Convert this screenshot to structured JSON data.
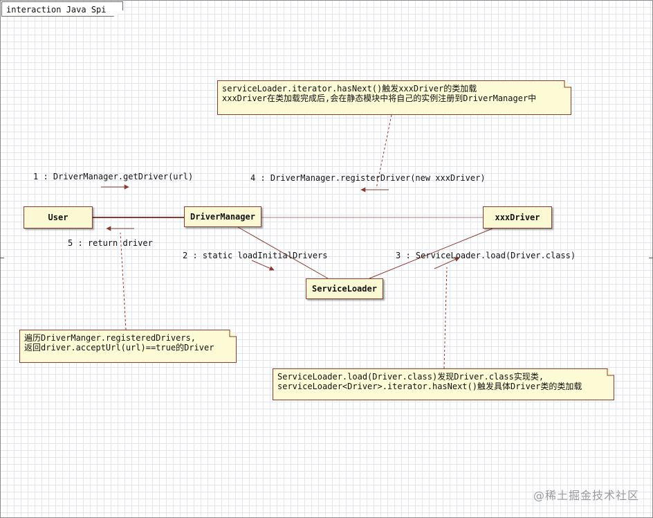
{
  "diagram": {
    "title": "interaction Java Spi",
    "lifelines": {
      "user": "User",
      "driver_manager": "DriverManager",
      "xxx_driver": "xxxDriver",
      "service_loader": "ServiceLoader"
    },
    "messages": {
      "m1": "1 : DriverManager.getDriver(url)",
      "m2": "2 : static loadInitialDrivers",
      "m3": "3 : ServiceLoader.load(Driver.class)",
      "m4": "4 : DriverManager.registerDriver(new xxxDriver)",
      "m5": "5 : return driver"
    },
    "notes": {
      "register": "serviceLoader.iterator.hasNext()触发xxxDriver的类加载\nxxxDriver在类加载完成后,会在静态模块中将自己的实例注册到DriverManager中",
      "iterate": "遍历DriverManger.registeredDrivers,\n返回driver.acceptUrl(url)==true的Driver",
      "load": "ServiceLoader.load(Driver.class)发现Driver.class实现类,\nserviceLoader<Driver>.iterator.hasNext()触发具体Driver类的类加载"
    },
    "colors": {
      "border": "#8b3a2e",
      "fill": "#fbf9d4",
      "grid": "#e3e6ef"
    }
  },
  "watermark": "@稀土掘金技术社区"
}
